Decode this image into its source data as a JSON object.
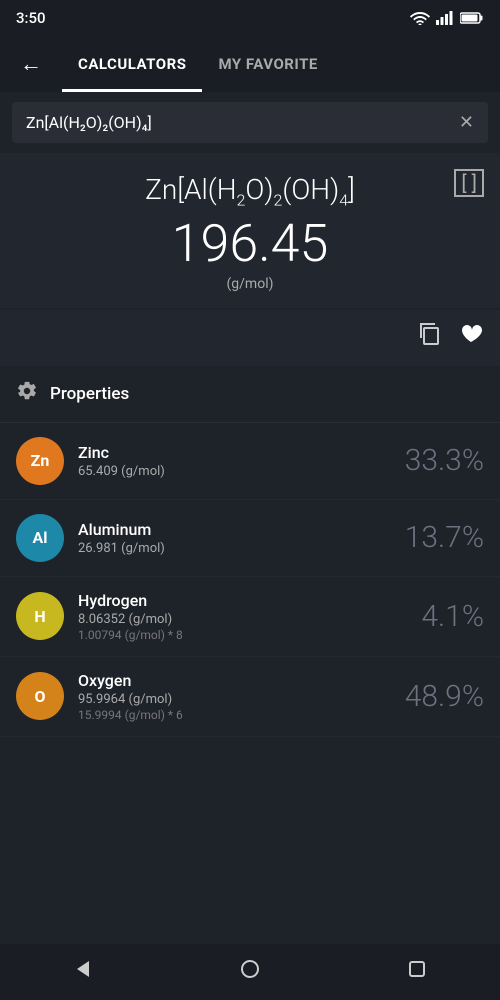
{
  "statusBar": {
    "time": "3:50"
  },
  "navigation": {
    "backLabel": "←",
    "tabs": [
      {
        "id": "calculators",
        "label": "CALCULATORS",
        "active": true
      },
      {
        "id": "my-favorite",
        "label": "MY FAVORITE",
        "active": false
      }
    ]
  },
  "search": {
    "value": "Zn[Al(H₂O)₂(OH)₄]",
    "clearLabel": "✕"
  },
  "formula": {
    "displayHTML": "Zn[Al(H<sub>2</sub>O)<sub>2</sub>(OH)<sub>4</sub>]",
    "molarMass": "196.45",
    "unit": "(g/mol)",
    "bracketLabel": "[ ]"
  },
  "actions": {
    "copyLabel": "⧉",
    "favoriteLabel": "♥"
  },
  "properties": {
    "label": "Properties"
  },
  "elements": [
    {
      "symbol": "Zn",
      "name": "Zinc",
      "mass": "65.409 (g/mol)",
      "detail": "",
      "percent": "33.3%",
      "color": "#e07820"
    },
    {
      "symbol": "Al",
      "name": "Aluminum",
      "mass": "26.981 (g/mol)",
      "detail": "",
      "percent": "13.7%",
      "color": "#1e88a8"
    },
    {
      "symbol": "H",
      "name": "Hydrogen",
      "mass": "8.06352 (g/mol)",
      "detail": "1.00794 (g/mol) * 8",
      "percent": "4.1%",
      "color": "#c8b820"
    },
    {
      "symbol": "O",
      "name": "Oxygen",
      "mass": "95.9964 (g/mol)",
      "detail": "15.9994 (g/mol) * 6",
      "percent": "48.9%",
      "color": "#d4821a"
    }
  ]
}
